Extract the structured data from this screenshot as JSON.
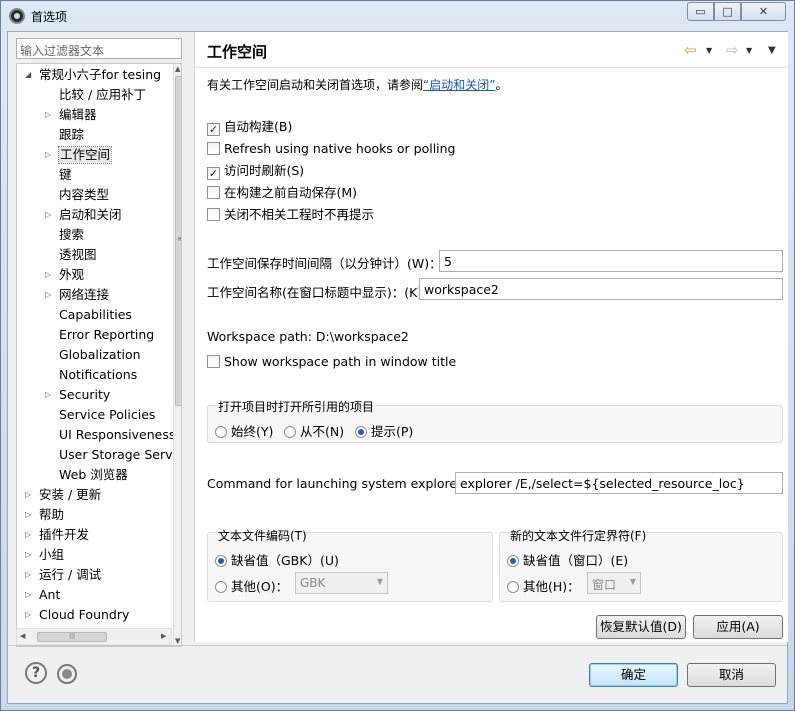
{
  "window": {
    "title": "首选项",
    "min_glyph": "▭",
    "max_glyph": "□",
    "close_glyph": "✕"
  },
  "filter": {
    "placeholder": "输入过滤器文本"
  },
  "tree": {
    "items": [
      {
        "label": "常规小六子for tesing",
        "twisty": "◢"
      },
      {
        "label": "比较 / 应用补丁",
        "twisty": ""
      },
      {
        "label": "编辑器",
        "twisty": "▷"
      },
      {
        "label": "跟踪",
        "twisty": ""
      },
      {
        "label": "工作空间",
        "twisty": "▷",
        "selected": true
      },
      {
        "label": "键",
        "twisty": ""
      },
      {
        "label": "内容类型",
        "twisty": ""
      },
      {
        "label": "启动和关闭",
        "twisty": "▷"
      },
      {
        "label": "搜索",
        "twisty": ""
      },
      {
        "label": "透视图",
        "twisty": ""
      },
      {
        "label": "外观",
        "twisty": "▷"
      },
      {
        "label": "网络连接",
        "twisty": "▷"
      },
      {
        "label": "Capabilities",
        "twisty": ""
      },
      {
        "label": "Error Reporting",
        "twisty": ""
      },
      {
        "label": "Globalization",
        "twisty": ""
      },
      {
        "label": "Notifications",
        "twisty": ""
      },
      {
        "label": "Security",
        "twisty": "▷"
      },
      {
        "label": "Service Policies",
        "twisty": ""
      },
      {
        "label": "UI Responsiveness",
        "twisty": ""
      },
      {
        "label": "User Storage Service",
        "twisty": ""
      },
      {
        "label": "Web 浏览器",
        "twisty": ""
      },
      {
        "label": "安装 / 更新",
        "twisty": "▷"
      },
      {
        "label": "帮助",
        "twisty": "▷"
      },
      {
        "label": "插件开发",
        "twisty": "▷"
      },
      {
        "label": "小组",
        "twisty": "▷"
      },
      {
        "label": "运行 / 调试",
        "twisty": "▷"
      },
      {
        "label": "Ant",
        "twisty": "▷"
      },
      {
        "label": "Cloud Foundry",
        "twisty": "▷"
      }
    ]
  },
  "page": {
    "title": "工作空间",
    "description_prefix": "有关工作空间启动和关闭首选项，请参阅",
    "description_link": "“启动和关闭”",
    "description_suffix": "。",
    "nav_back": "⇦",
    "nav_fwd": "⇨",
    "nav_drop": "▼",
    "checkboxes": [
      {
        "label": "自动构建(B)",
        "checked": true
      },
      {
        "label": "Refresh using native hooks or polling",
        "checked": false
      },
      {
        "label": "访问时刷新(S)",
        "checked": true
      },
      {
        "label": "在构建之前自动保存(M)",
        "checked": false
      },
      {
        "label": "关闭不相关工程时不再提示",
        "checked": false
      }
    ],
    "save_interval_label": "工作空间保存时间间隔（以分钟计）(W)：",
    "save_interval_value": "5",
    "ws_name_label": "工作空间名称(在窗口标题中显示)：(K)",
    "ws_name_value": "workspace2",
    "ws_path_label": "Workspace path:",
    "ws_path_value": "D:\\workspace2",
    "show_path_label": "Show workspace path in window title",
    "open_ref_group": {
      "title": "打开项目时打开所引用的项目",
      "options": [
        {
          "label": "始终(Y)",
          "selected": false
        },
        {
          "label": "从不(N)",
          "selected": false
        },
        {
          "label": "提示(P)",
          "selected": true
        }
      ]
    },
    "explorer_label": "Command for launching system explorer:",
    "explorer_value": "explorer /E,/select=${selected_resource_loc}",
    "encoding_group": {
      "title": "文本文件编码(T)",
      "default_label": "缺省值（GBK）(U)",
      "other_label": "其他(O)：",
      "other_value": "GBK"
    },
    "delimiter_group": {
      "title": "新的文本文件行定界符(F)",
      "default_label": "缺省值（窗口）(E)",
      "other_label": "其他(H)：",
      "other_value": "窗口"
    },
    "restore_defaults": "恢复默认值(D)",
    "apply": "应用(A)"
  },
  "footer": {
    "help_glyph": "?",
    "ok": "确定",
    "cancel": "取消"
  }
}
